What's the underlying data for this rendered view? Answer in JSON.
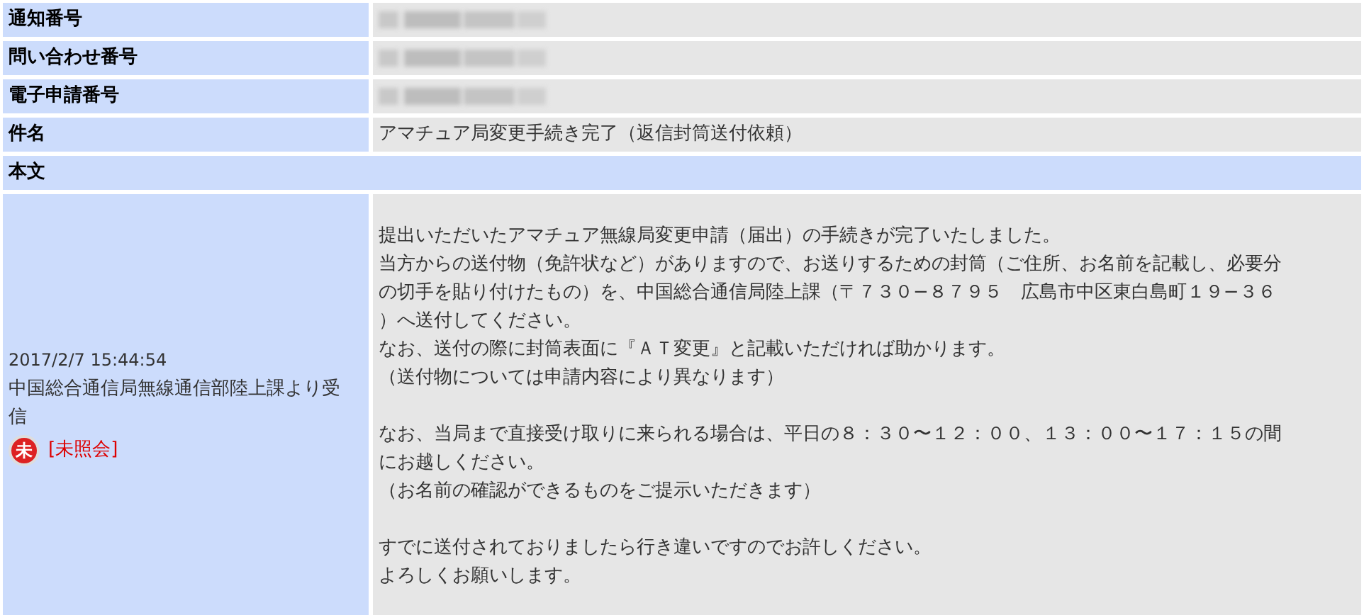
{
  "fields": [
    {
      "label": "通知番号",
      "redacted": true
    },
    {
      "label": "問い合わせ番号",
      "redacted": true
    },
    {
      "label": "電子申請番号",
      "redacted": true
    },
    {
      "label": "件名",
      "redacted": false,
      "value": "アマチュア局変更手続き完了（返信封筒送付依頼）"
    }
  ],
  "body": {
    "label": "本文",
    "meta": {
      "datetime": "2017/2/7 15:44:54",
      "sender": [
        "中国総合通信局無線通信部陸上課より受",
        "信"
      ],
      "badge_char": "未",
      "read": false,
      "status": "[未照会]"
    },
    "paragraphs": [
      [
        "提出いただいたアマチュア無線局変更申請（届出）の手続きが完了いたしました。",
        "当方からの送付物（免許状など）がありますので、お送りするための封筒（ご住所、お名前を記載し、必要分",
        "の切手を貼り付けたもの）を、中国総合通信局陸上課（〒７３０−８７９５　広島市中区東白島町１９−３６",
        "）へ送付してください。",
        "なお、送付の際に封筒表面に『ＡＴ変更』と記載いただければ助かります。",
        "（送付物については申請内容により異なります）"
      ],
      [
        "なお、当局まで直接受け取りに来られる場合は、平日の８：３０〜１２：００、１３：００〜１７：１５の間",
        "にお越しください。",
        "（お名前の確認ができるものをご提示いただきます）"
      ],
      [
        "すでに送付されておりましたら行き違いですのでお許しください。",
        "よろしくお願いします。"
      ]
    ]
  }
}
